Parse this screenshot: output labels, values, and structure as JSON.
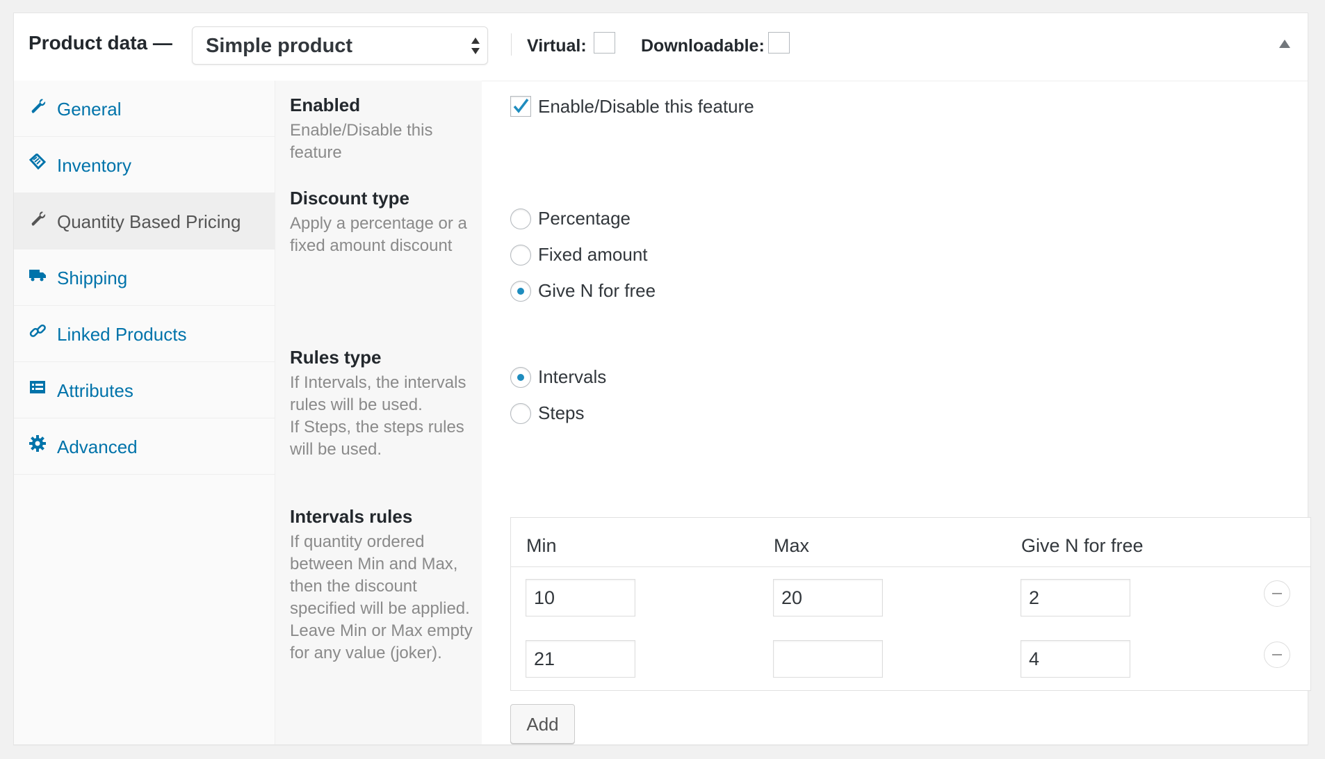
{
  "header": {
    "title": "Product data —",
    "product_type": "Simple product",
    "virtual_label": "Virtual:",
    "downloadable_label": "Downloadable:"
  },
  "sidebar": {
    "items": [
      {
        "label": "General",
        "icon": "wrench-icon"
      },
      {
        "label": "Inventory",
        "icon": "tag-icon"
      },
      {
        "label": "Quantity Based Pricing",
        "icon": "wrench-icon",
        "active": true
      },
      {
        "label": "Shipping",
        "icon": "truck-icon"
      },
      {
        "label": "Linked Products",
        "icon": "link-icon"
      },
      {
        "label": "Attributes",
        "icon": "list-icon"
      },
      {
        "label": "Advanced",
        "icon": "gear-icon"
      }
    ]
  },
  "fields": {
    "enabled": {
      "title": "Enabled",
      "desc": "Enable/Disable this feature",
      "checkbox_label": "Enable/Disable this feature",
      "checked": true
    },
    "discount_type": {
      "title": "Discount type",
      "desc": "Apply a percentage or a fixed amount discount",
      "options": [
        "Percentage",
        "Fixed amount",
        "Give N for free"
      ],
      "selected": "Give N for free"
    },
    "rules_type": {
      "title": "Rules type",
      "desc": "If Intervals, the intervals rules will be used.\nIf Steps, the steps rules will be used.",
      "options": [
        "Intervals",
        "Steps"
      ],
      "selected": "Intervals"
    },
    "intervals_rules": {
      "title": "Intervals rules",
      "desc": "If quantity ordered between Min and Max, then the discount specified will be applied.\nLeave Min or Max empty for any value (joker).",
      "columns": [
        "Min",
        "Max",
        "Give N for free"
      ],
      "rows": [
        {
          "min": "10",
          "max": "20",
          "free": "2"
        },
        {
          "min": "21",
          "max": "",
          "free": "4"
        }
      ],
      "add_label": "Add"
    }
  },
  "colors": {
    "link": "#0073aa",
    "radio_dot": "#1e8cbe",
    "label_bg": "#f7f7f7"
  }
}
